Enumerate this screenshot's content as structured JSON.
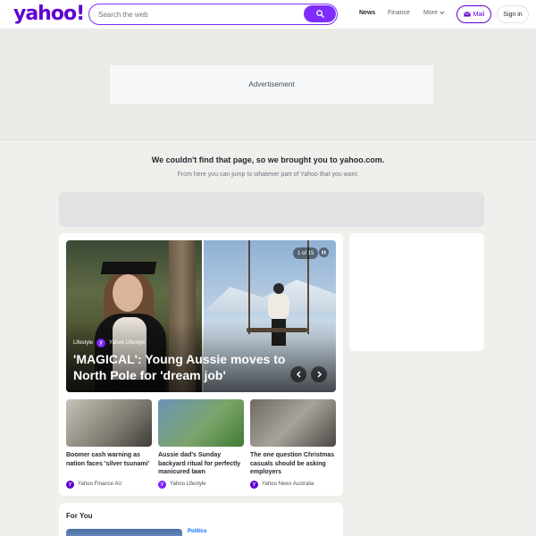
{
  "header": {
    "logo": "yahoo!",
    "search_placeholder": "Search the web",
    "nav": [
      "News",
      "Finance",
      "More"
    ],
    "mail_label": "Mail",
    "signin_label": "Sign in"
  },
  "ad": {
    "label": "Advertisement"
  },
  "notice": {
    "title": "We couldn't find that page, so we brought you to yahoo.com.",
    "subtitle": "From here you can jump to whatever part of Yahoo that you want."
  },
  "hero": {
    "counter": "1 of 15",
    "category": "Lifestyle",
    "source": "Yahoo Lifestyle",
    "title": "'MAGICAL': Young Aussie moves to North Pole for 'dream job'"
  },
  "stories": [
    {
      "title": "Boomer cash warning as nation faces 'silver tsunami'",
      "source": "Yahoo Finance AU"
    },
    {
      "title": "Aussie dad's Sunday backyard ritual for perfectly manicured lawn",
      "source": "Yahoo Lifestyle"
    },
    {
      "title": "The one question Christmas casuals should be asking employers",
      "source": "Yahoo News Australia"
    }
  ],
  "for_you": {
    "title": "For You",
    "first_category": "Politics"
  },
  "colors": {
    "brand": "#6001d2",
    "accent": "#7d2eff",
    "link": "#0f69ff"
  },
  "icons": [
    "search-icon",
    "mail-icon",
    "chevron-down-icon",
    "pause-icon",
    "chevron-left-icon",
    "chevron-right-icon"
  ]
}
